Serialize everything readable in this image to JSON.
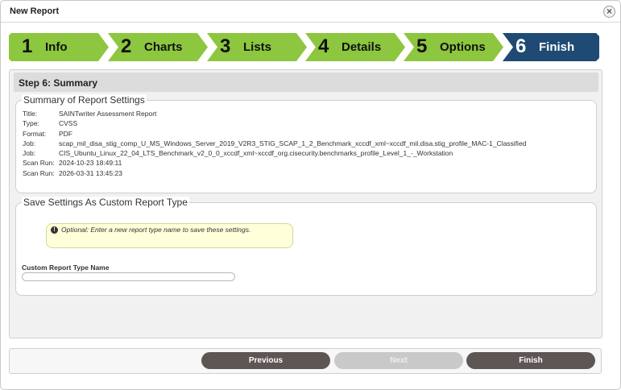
{
  "window": {
    "title": "New Report",
    "close_icon": "close-icon"
  },
  "colors": {
    "step_green": "#8dc63f",
    "step_active": "#1f4a73",
    "button_dark": "#5d5654",
    "button_disabled": "#c9c9c9",
    "note_bg": "#ffffd9"
  },
  "steps": [
    {
      "num": "1",
      "label": "Info",
      "active": false
    },
    {
      "num": "2",
      "label": "Charts",
      "active": false
    },
    {
      "num": "3",
      "label": "Lists",
      "active": false
    },
    {
      "num": "4",
      "label": "Details",
      "active": false
    },
    {
      "num": "5",
      "label": "Options",
      "active": false
    },
    {
      "num": "6",
      "label": "Finish",
      "active": true
    }
  ],
  "panel": {
    "header": "Step 6: Summary"
  },
  "summary": {
    "legend": "Summary of Report Settings",
    "rows": [
      {
        "key": "Title:",
        "value": "SAINTwriter Assessment Report"
      },
      {
        "key": "Type:",
        "value": "CVSS"
      },
      {
        "key": "Format:",
        "value": "PDF"
      },
      {
        "key": "Job:",
        "value": "scap_mil_disa_stig_comp_U_MS_Windows_Server_2019_V2R3_STIG_SCAP_1_2_Benchmark_xccdf_xml~xccdf_mil.disa.stig_profile_MAC-1_Classified"
      },
      {
        "key": "Job:",
        "value": "CIS_Ubuntu_Linux_22_04_LTS_Benchmark_v2_0_0_xccdf_xml~xccdf_org.cisecurity.benchmarks_profile_Level_1_-_Workstation"
      },
      {
        "key": "Scan Run:",
        "value": "2024-10-23 18:49:11"
      },
      {
        "key": "Scan Run:",
        "value": "2026-03-31 13:45:23"
      }
    ]
  },
  "save": {
    "legend": "Save Settings As Custom Report Type",
    "note_icon": "info-icon",
    "note_prefix": "Optional:",
    "note_text": " Enter a new report type name to save these settings.",
    "field_label": "Custom Report Type Name",
    "field_value": ""
  },
  "buttons": {
    "previous": "Previous",
    "next": "Next",
    "finish": "Finish"
  }
}
